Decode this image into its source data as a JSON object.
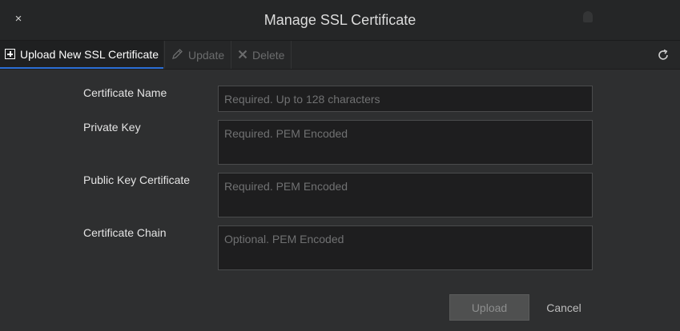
{
  "dialog": {
    "title": "Manage SSL Certificate",
    "close_glyph": "×"
  },
  "toolbar": {
    "upload_label": "Upload New SSL Certificate",
    "update_label": "Update",
    "delete_label": "Delete",
    "icons": {
      "upload": "plus-box-icon",
      "update": "pencil-icon",
      "delete": "x-icon",
      "refresh": "refresh-icon"
    }
  },
  "form": {
    "certificate_name": {
      "label": "Certificate Name",
      "placeholder": "Required. Up to 128 characters",
      "value": ""
    },
    "private_key": {
      "label": "Private Key",
      "placeholder": "Required. PEM Encoded",
      "value": ""
    },
    "public_key_certificate": {
      "label": "Public Key Certificate",
      "placeholder": "Required. PEM Encoded",
      "value": ""
    },
    "certificate_chain": {
      "label": "Certificate Chain",
      "placeholder": "Optional. PEM Encoded",
      "value": ""
    }
  },
  "footer": {
    "upload_label": "Upload",
    "cancel_label": "Cancel"
  },
  "colors": {
    "accent": "#2b6fd6",
    "background": "#2e2f30",
    "field_background": "#1e1e1f"
  }
}
